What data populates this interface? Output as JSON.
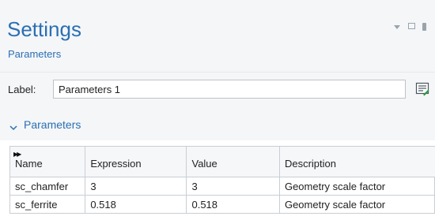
{
  "header": {
    "title": "Settings",
    "subtitle": "Parameters"
  },
  "label": {
    "caption": "Label:",
    "value": "Parameters 1"
  },
  "section": {
    "title": "Parameters"
  },
  "table": {
    "columns": [
      "Name",
      "Expression",
      "Value",
      "Description"
    ],
    "rows": [
      {
        "name": "sc_chamfer",
        "expression": "3",
        "value": "3",
        "description": "Geometry scale factor"
      },
      {
        "name": "sc_ferrite",
        "expression": "0.518",
        "value": "0.518",
        "description": "Geometry scale factor"
      }
    ]
  },
  "icons": {
    "window_menu": "triangle-down-icon",
    "window_restore": "restore-icon",
    "window_pin": "pin-icon",
    "label_action": "edit-label-icon",
    "section_toggle": "chevron-down-icon",
    "table_expand": "expand-icon"
  },
  "colors": {
    "accent": "#2b6fb3",
    "panel_bg": "#f4f6f8",
    "border": "#c8ced5"
  }
}
